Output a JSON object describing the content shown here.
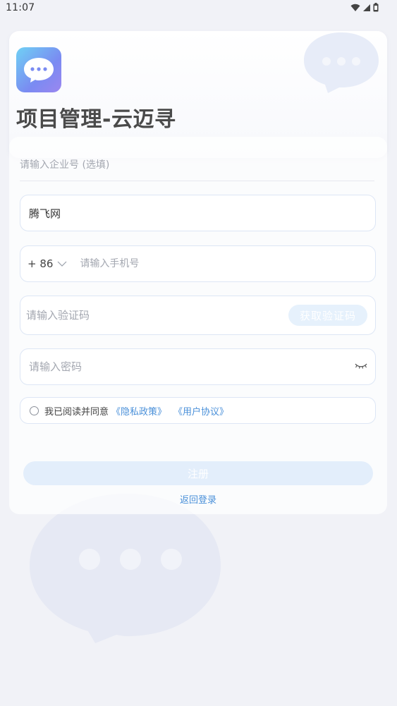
{
  "status_bar": {
    "time": "11:07",
    "icons": [
      "wifi-icon",
      "signal-icon",
      "battery-icon"
    ]
  },
  "header": {
    "title": "项目管理-云迈寻",
    "logo_icon": "chat-bubble-icon"
  },
  "form": {
    "company": {
      "placeholder": "请输入企业号 (选填)",
      "value": ""
    },
    "name": {
      "value": "腾飞网"
    },
    "phone": {
      "country_code": "+ 86",
      "placeholder": "请输入手机号",
      "value": ""
    },
    "code": {
      "placeholder": "请输入验证码",
      "button_label": "获取验证码"
    },
    "password": {
      "placeholder": "请输入密码",
      "toggle_icon": "eye-closed-icon"
    },
    "agreement": {
      "text": "我已阅读并同意",
      "privacy_link": "《隐私政策》",
      "terms_link": "《用户协议》",
      "checked": false
    },
    "register_label": "注册",
    "back_login_label": "返回登录"
  },
  "colors": {
    "accent": "#4a90d9",
    "background": "#f1f2f7",
    "button_disabled": "#e3eefb",
    "logo_gradient_start": "#6fd1f4",
    "logo_gradient_end": "#9b86f0"
  }
}
